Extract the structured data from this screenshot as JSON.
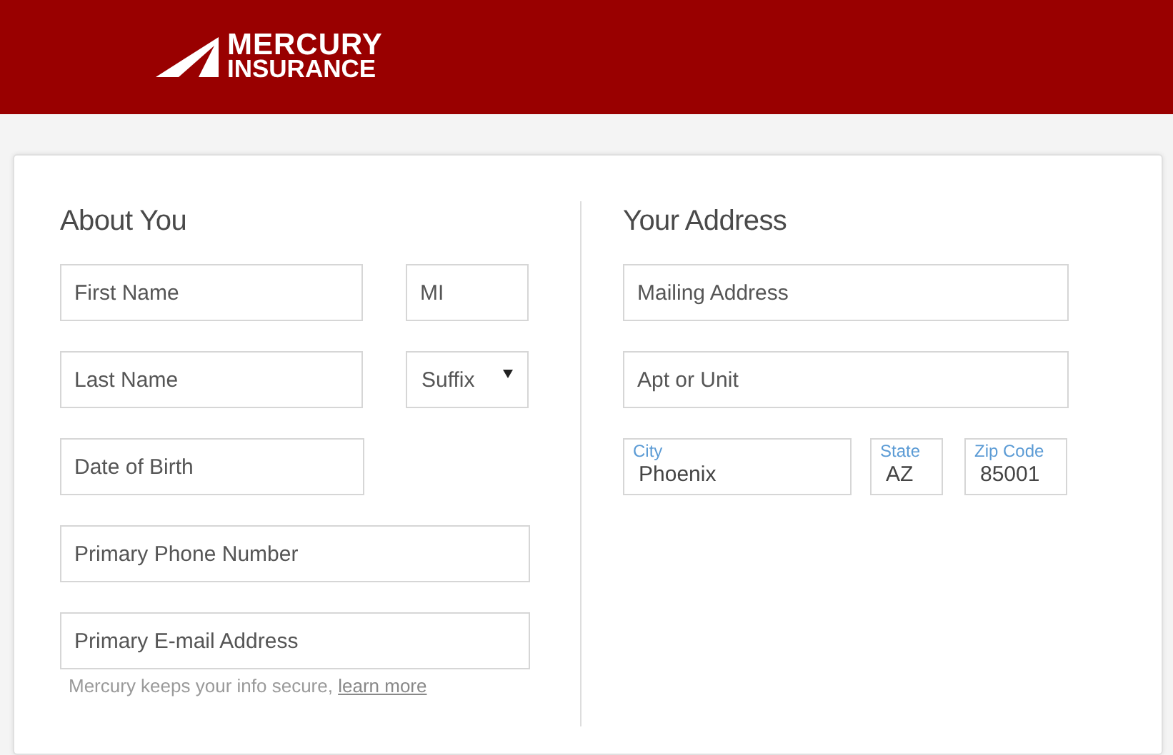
{
  "header": {
    "logo": {
      "line_1": "MERCURY",
      "line_2": "INSURANCE"
    }
  },
  "about": {
    "title": "About You",
    "rows": [
      [
        {
          "kind": "text",
          "placeholder": "First Name"
        },
        {
          "kind": "text",
          "placeholder": "MI"
        }
      ],
      [
        {
          "kind": "text",
          "placeholder": "Last Name"
        },
        {
          "kind": "select",
          "placeholder": "Suffix"
        }
      ],
      [
        {
          "kind": "text",
          "placeholder": "Date of Birth"
        }
      ],
      [
        {
          "kind": "text",
          "placeholder": "Primary Phone Number"
        }
      ],
      [
        {
          "kind": "text",
          "placeholder": "Primary E-mail Address"
        }
      ]
    ],
    "note": {
      "text": "Mercury keeps your info secure,",
      "link": "learn more"
    }
  },
  "address": {
    "title": "Your Address",
    "rows": [
      [
        {
          "kind": "text",
          "placeholder": "Mailing Address"
        }
      ],
      [
        {
          "kind": "text",
          "placeholder": "Apt or Unit"
        }
      ],
      [
        {
          "kind": "floating",
          "label": "City",
          "value": "Phoenix"
        },
        {
          "kind": "floating",
          "label": "State",
          "value": "AZ"
        },
        {
          "kind": "floating",
          "label": "Zip Code",
          "value": "85001"
        }
      ]
    ]
  }
}
